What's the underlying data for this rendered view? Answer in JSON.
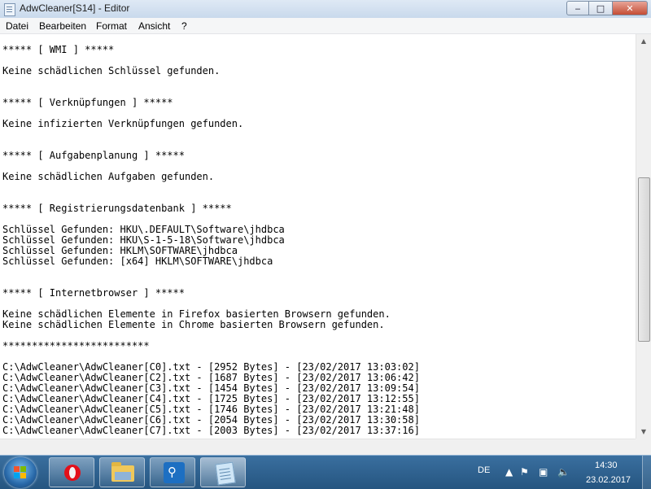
{
  "window": {
    "title": "AdwCleaner[S14] - Editor",
    "icon": "notepad-icon",
    "buttons": {
      "minimize": "minimize-icon",
      "maximize": "maximize-icon",
      "close": "close-icon"
    }
  },
  "menu": {
    "items": [
      "Datei",
      "Bearbeiten",
      "Format",
      "Ansicht",
      "?"
    ]
  },
  "editor": {
    "lines": [
      "***** [ WMI ] *****",
      "",
      "Keine schädlichen Schlüssel gefunden.",
      "",
      "",
      "***** [ Verknüpfungen ] *****",
      "",
      "Keine infizierten Verknüpfungen gefunden.",
      "",
      "",
      "***** [ Aufgabenplanung ] *****",
      "",
      "Keine schädlichen Aufgaben gefunden.",
      "",
      "",
      "***** [ Registrierungsdatenbank ] *****",
      "",
      "Schlüssel Gefunden: HKU\\.DEFAULT\\Software\\jhdbca",
      "Schlüssel Gefunden: HKU\\S-1-5-18\\Software\\jhdbca",
      "Schlüssel Gefunden: HKLM\\SOFTWARE\\jhdbca",
      "Schlüssel Gefunden: [x64] HKLM\\SOFTWARE\\jhdbca",
      "",
      "",
      "***** [ Internetbrowser ] *****",
      "",
      "Keine schädlichen Elemente in Firefox basierten Browsern gefunden.",
      "Keine schädlichen Elemente in Chrome basierten Browsern gefunden.",
      "",
      "*************************",
      "",
      "C:\\AdwCleaner\\AdwCleaner[C0].txt - [2952 Bytes] - [23/02/2017 13:03:02]",
      "C:\\AdwCleaner\\AdwCleaner[C2].txt - [1687 Bytes] - [23/02/2017 13:06:42]",
      "C:\\AdwCleaner\\AdwCleaner[C3].txt - [1454 Bytes] - [23/02/2017 13:09:54]",
      "C:\\AdwCleaner\\AdwCleaner[C4].txt - [1725 Bytes] - [23/02/2017 13:12:55]",
      "C:\\AdwCleaner\\AdwCleaner[C5].txt - [1746 Bytes] - [23/02/2017 13:21:48]",
      "C:\\AdwCleaner\\AdwCleaner[C6].txt - [2054 Bytes] - [23/02/2017 13:30:58]",
      "C:\\AdwCleaner\\AdwCleaner[C7].txt - [2003 Bytes] - [23/02/2017 13:37:16]"
    ]
  },
  "taskbar": {
    "apps": [
      "start-orb",
      "opera-browser",
      "windows-explorer",
      "search-app",
      "notepad"
    ],
    "tray": {
      "language": "DE",
      "icons": [
        "up-arrow-icon",
        "flag-icon",
        "network-icon",
        "volume-icon"
      ],
      "time": "14:30",
      "date": "23.02.2017"
    }
  },
  "colors": {
    "taskbar": "#255580",
    "close_button": "#c44d35",
    "opera_red": "#e3101a"
  }
}
